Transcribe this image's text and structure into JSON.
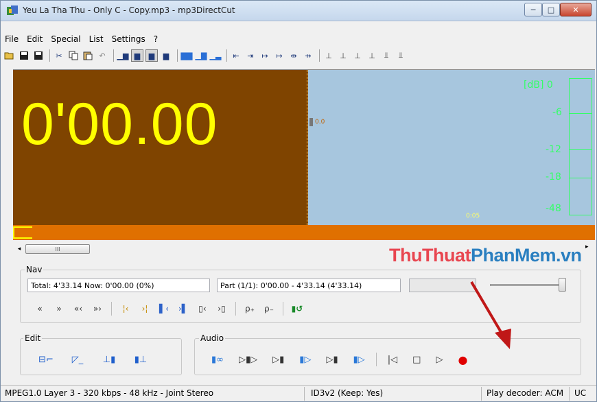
{
  "window": {
    "title": "Yeu La Tha Thu - Only C - Copy.mp3 - mp3DirectCut",
    "controls": {
      "minimize": "─",
      "maximize": "□",
      "close": "✕"
    }
  },
  "menu": [
    "File",
    "Edit",
    "Special",
    "List",
    "Settings",
    "?"
  ],
  "toolbar": {
    "icons": [
      "open-icon",
      "save-icon",
      "save-list-icon",
      "cut-icon",
      "copy-icon",
      "paste-icon",
      "undo-icon",
      "wave-view-1-icon",
      "wave-view-2-icon",
      "wave-view-3-icon",
      "wave-view-4-icon",
      "level-1-icon",
      "level-2-icon",
      "level-3-icon",
      "cue-1-icon",
      "cue-2-icon",
      "cue-3-icon",
      "cue-4-icon",
      "cue-5-icon",
      "cue-6-icon",
      "marker-1-icon",
      "marker-2-icon",
      "marker-3-icon",
      "marker-4-icon",
      "marker-5-icon",
      "marker-6-icon"
    ]
  },
  "display": {
    "time": "0'00.00",
    "marker_label": "0.0",
    "db_labels": [
      "[dB]  0",
      "-6",
      "-12",
      "-18",
      "-48"
    ],
    "bottom_label": "0:05",
    "colors": {
      "time_bg": "#7f4400",
      "time_text": "#ffff00",
      "wave_bg": "#a7c6de",
      "meter": "#33ff66",
      "bar": "#e07000"
    }
  },
  "scrollbar": {
    "thumb_grip": "III"
  },
  "watermark": {
    "part1": "ThuThuat",
    "part2": "PhanMem.vn"
  },
  "nav": {
    "title": "Nav",
    "total": "Total: 4'33.14   Now: 0'00.00  (0%)",
    "part": "Part (1/1): 0'00.00 - 4'33.14 (4'33.14)",
    "volume_level": 1.0,
    "buttons": [
      "«",
      "»",
      "«‹",
      "»›",
      "¦‹",
      "›¦",
      "▌‹",
      "›▌",
      "▯‹",
      "›▯",
      "ρ₊",
      "ρ₋",
      "▮↺"
    ]
  },
  "edit": {
    "title": "Edit",
    "buttons": [
      "⊟⌐",
      "◸_",
      "⊥▮",
      "▮⊥"
    ]
  },
  "audio": {
    "title": "Audio",
    "buttons": [
      "▮∞",
      "▷▮▷",
      "▷▮",
      "▮▷",
      "▷▮",
      "▮▷",
      "|◁",
      "□",
      "▷",
      "●"
    ]
  },
  "status": {
    "format": "MPEG1.0 Layer 3 - 320 kbps - 48 kHz - Joint Stereo",
    "id3": "ID3v2 (Keep: Yes)",
    "decoder": "Play decoder: ACM",
    "mode": "UC"
  }
}
